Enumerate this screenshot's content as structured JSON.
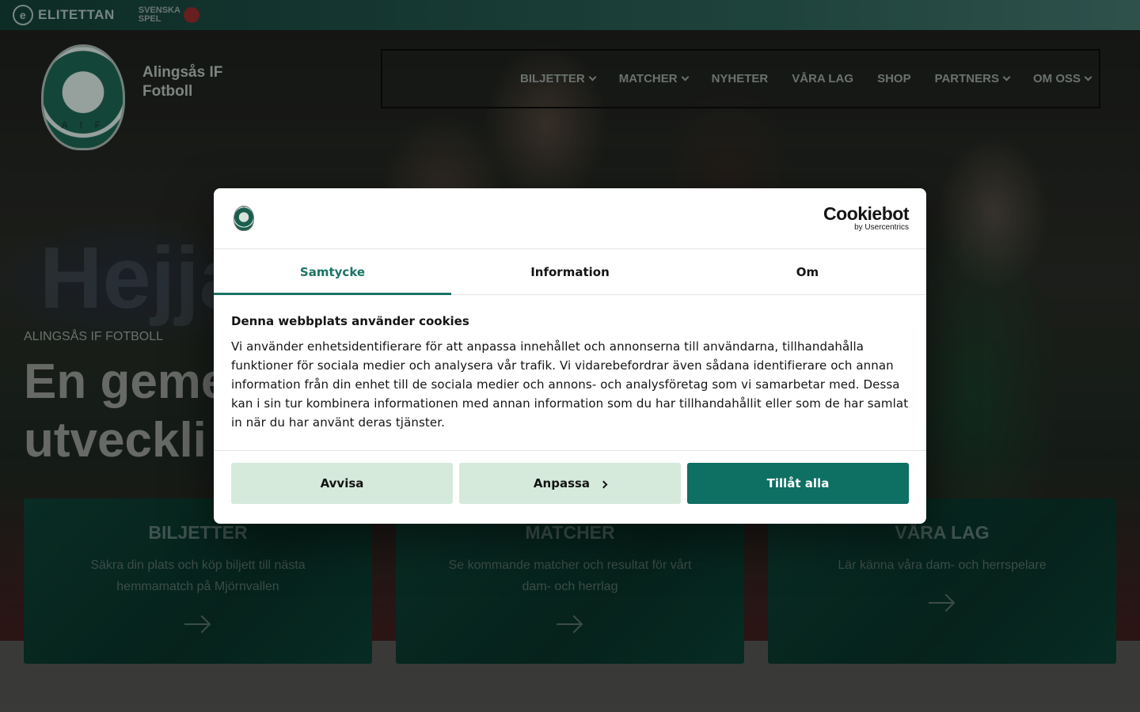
{
  "topbar": {
    "sponsor1": "ELITETTAN",
    "sponsor1_mark": "e",
    "sponsor2_line1": "SVENSKA",
    "sponsor2_line2": "SPEL"
  },
  "brand": {
    "crest_text": "A I F",
    "name_line1": "Alingsås IF",
    "name_line2": "Fotboll"
  },
  "nav": {
    "items": [
      {
        "label": "BILJETTER",
        "dropdown": true
      },
      {
        "label": "MATCHER",
        "dropdown": true
      },
      {
        "label": "NYHETER",
        "dropdown": false
      },
      {
        "label": "VÅRA LAG",
        "dropdown": false
      },
      {
        "label": "SHOP",
        "dropdown": false
      },
      {
        "label": "PARTNERS",
        "dropdown": true
      },
      {
        "label": "OM OSS",
        "dropdown": true
      }
    ]
  },
  "hero": {
    "bg_word": "Hejja",
    "kicker": "ALINGSÅS IF FOTBOLL",
    "title_line1": "En geme",
    "title_line2": "utveckli"
  },
  "cards": [
    {
      "title": "BILJETTER",
      "text": "Säkra din plats och köp biljett till nästa hemmamatch på Mjörnvallen"
    },
    {
      "title": "MATCHER",
      "text": "Se kommande matcher och resultat för vårt dam- och herrlag"
    },
    {
      "title": "VÅRA LAG",
      "text": "Lär känna våra dam- och herrspelare"
    }
  ],
  "cookie_dialog": {
    "provider": "Cookiebot",
    "provider_sub": "by Usercentrics",
    "tabs": [
      "Samtycke",
      "Information",
      "Om"
    ],
    "active_tab": "Samtycke",
    "heading": "Denna webbplats använder cookies",
    "body": "Vi använder enhetsidentifierare för att anpassa innehållet och annonserna till användarna, tillhandahålla funktioner för sociala medier och analysera vår trafik. Vi vidarebefordrar även sådana identifierare och annan information från din enhet till de sociala medier och annons- och analysföretag som vi samarbetar med. Dessa kan i sin tur kombinera informationen med annan information som du har tillhandahållit eller som de har samlat in när du har använt deras tjänster.",
    "buttons": {
      "reject": "Avvisa",
      "customize": "Anpassa",
      "accept": "Tillåt alla"
    }
  },
  "colors": {
    "accent": "#1a7466",
    "primary_button": "#0e6f63",
    "light_button": "#d6eadc"
  }
}
